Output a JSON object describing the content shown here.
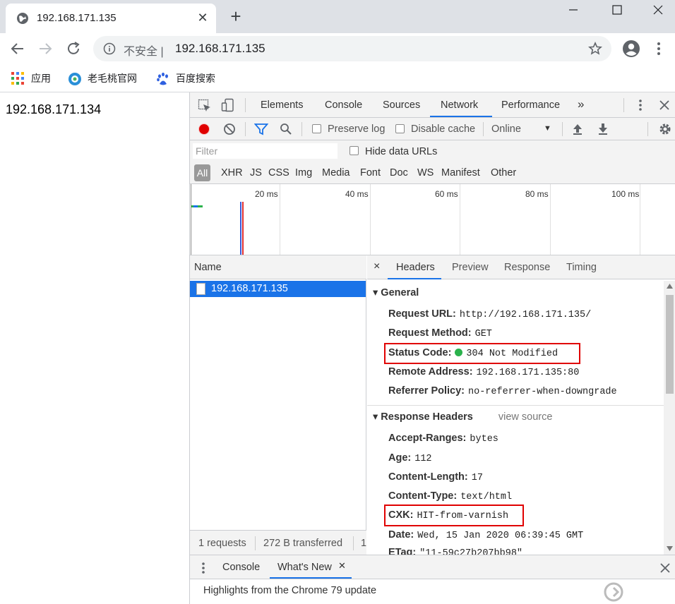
{
  "browser": {
    "tab_title": "192.168.171.135",
    "tab_close": "✕",
    "new_tab": "+",
    "insecure_label": "不安全 |",
    "url": "192.168.171.135",
    "bookmarks": [
      {
        "label": "应用",
        "icon": "apps-grid-icon"
      },
      {
        "label": "老毛桃官网",
        "icon": "site-favicon-icon"
      },
      {
        "label": "百度搜索",
        "icon": "baidu-paw-icon"
      }
    ]
  },
  "page": {
    "body_text": "192.168.171.134"
  },
  "devtools": {
    "tabs": [
      "Elements",
      "Console",
      "Sources",
      "Network",
      "Performance",
      "»"
    ],
    "active_tab": "Network",
    "toolbar": {
      "preserve_log": "Preserve log",
      "disable_cache": "Disable cache",
      "throttle": "Online",
      "throttle_arrow": "▼"
    },
    "filter": {
      "placeholder": "Filter",
      "hide_data_urls": "Hide data URLs"
    },
    "types": [
      "All",
      "XHR",
      "JS",
      "CSS",
      "Img",
      "Media",
      "Font",
      "Doc",
      "WS",
      "Manifest",
      "Other"
    ],
    "timeline_labels": [
      "20 ms",
      "40 ms",
      "60 ms",
      "80 ms",
      "100 ms"
    ],
    "name_header": "Name",
    "requests": [
      {
        "name": "192.168.171.135"
      }
    ],
    "detail_tabs": [
      "×",
      "Headers",
      "Preview",
      "Response",
      "Timing"
    ],
    "general": {
      "title": "▾ General",
      "request_url_k": "Request URL:",
      "request_url_v": "http://192.168.171.135/",
      "request_method_k": "Request Method:",
      "request_method_v": "GET",
      "status_code_k": "Status Code:",
      "status_code_v": "304 Not Modified",
      "remote_address_k": "Remote Address:",
      "remote_address_v": "192.168.171.135:80",
      "referrer_policy_k": "Referrer Policy:",
      "referrer_policy_v": "no-referrer-when-downgrade"
    },
    "response_headers": {
      "title": "▾ Response Headers",
      "view_source": "view source",
      "accept_ranges_k": "Accept-Ranges:",
      "accept_ranges_v": "bytes",
      "age_k": "Age:",
      "age_v": "112",
      "content_length_k": "Content-Length:",
      "content_length_v": "17",
      "content_type_k": "Content-Type:",
      "content_type_v": "text/html",
      "cxk_k": "CXK:",
      "cxk_v": "HIT-from-varnish",
      "date_k": "Date:",
      "date_v": "Wed, 15 Jan 2020 06:39:45 GMT",
      "etag_k": "ETag:",
      "etag_v": "\"11-59c27b207bb98\""
    },
    "stats": {
      "requests": "1 requests",
      "transferred": "272 B transferred",
      "extra": "1"
    },
    "drawer": {
      "tabs": [
        "Console",
        "What's New"
      ],
      "close_tab": "✕",
      "content": "Highlights from the Chrome 79 update"
    },
    "colors": {
      "accent": "#1a73e8",
      "highlight_box": "#e00000",
      "status_ok": "#2bb24c",
      "record": "#e00000"
    }
  }
}
